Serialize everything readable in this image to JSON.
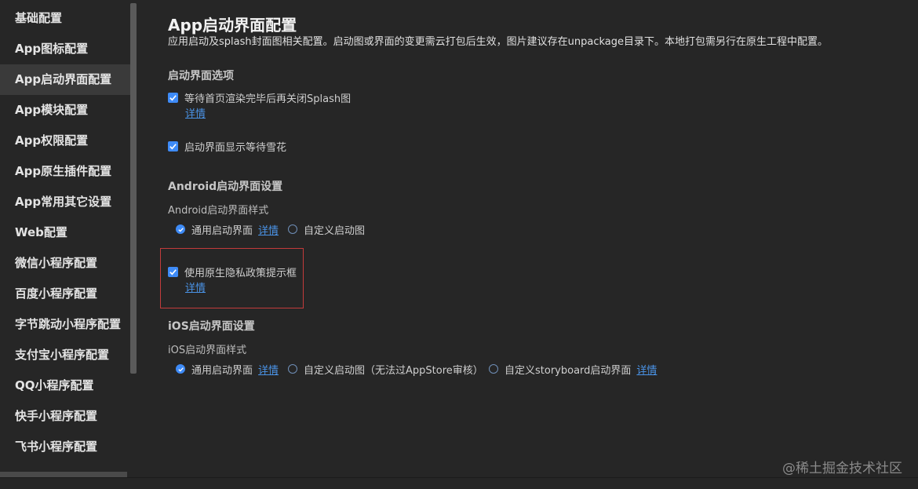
{
  "sidebar": {
    "items": [
      {
        "label": "基础配置"
      },
      {
        "label": "App图标配置"
      },
      {
        "label": "App启动界面配置"
      },
      {
        "label": "App模块配置"
      },
      {
        "label": "App权限配置"
      },
      {
        "label": "App原生插件配置"
      },
      {
        "label": "App常用其它设置"
      },
      {
        "label": "Web配置"
      },
      {
        "label": "微信小程序配置"
      },
      {
        "label": "百度小程序配置"
      },
      {
        "label": "字节跳动小程序配置"
      },
      {
        "label": "支付宝小程序配置"
      },
      {
        "label": "QQ小程序配置"
      },
      {
        "label": "快手小程序配置"
      },
      {
        "label": "飞书小程序配置"
      }
    ],
    "active_index": 2
  },
  "main": {
    "title": "App启动界面配置",
    "description": "应用启动及splash封面图相关配置。启动图或界面的变更需云打包后生效，图片建议存在unpackage目录下。本地打包需另行在原生工程中配置。",
    "splash_options": {
      "title": "启动界面选项",
      "wait_render": {
        "label": "等待首页渲染完毕后再关闭Splash图",
        "checked": true,
        "detail_link": "详情"
      },
      "show_waiting": {
        "label": "启动界面显示等待雪花",
        "checked": true
      }
    },
    "android": {
      "title": "Android启动界面设置",
      "style_label": "Android启动界面样式",
      "options": [
        {
          "label": "通用启动界面",
          "checked": true,
          "link": "详情"
        },
        {
          "label": "自定义启动图",
          "checked": false
        }
      ],
      "privacy": {
        "label": "使用原生隐私政策提示框",
        "checked": true,
        "detail_link": "详情"
      }
    },
    "ios": {
      "title": "iOS启动界面设置",
      "style_label": "iOS启动界面样式",
      "options": [
        {
          "label": "通用启动界面",
          "checked": true,
          "link": "详情"
        },
        {
          "label": "自定义启动图（无法过AppStore审核）",
          "checked": false
        },
        {
          "label": "自定义storyboard启动界面",
          "checked": false,
          "link": "详情"
        }
      ]
    }
  },
  "watermark": "@稀土掘金技术社区",
  "colors": {
    "accent": "#3e8bf7",
    "link": "#4a93e6",
    "highlight": "#c33b3b",
    "background": "#262626"
  }
}
